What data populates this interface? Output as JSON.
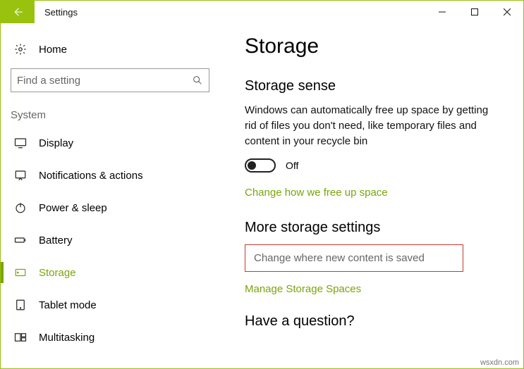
{
  "window": {
    "title": "Settings",
    "watermark": "wsxdn.com"
  },
  "sidebar": {
    "home": "Home",
    "search_placeholder": "Find a setting",
    "group": "System",
    "items": [
      {
        "label": "Display"
      },
      {
        "label": "Notifications & actions"
      },
      {
        "label": "Power & sleep"
      },
      {
        "label": "Battery"
      },
      {
        "label": "Storage"
      },
      {
        "label": "Tablet mode"
      },
      {
        "label": "Multitasking"
      }
    ]
  },
  "page": {
    "title": "Storage",
    "section1": {
      "heading": "Storage sense",
      "desc": "Windows can automatically free up space by getting rid of files you don't need, like temporary files and content in your recycle bin",
      "toggle_state": "Off",
      "link1": "Change how we free up space"
    },
    "section2": {
      "heading": "More storage settings",
      "boxed": "Change where new content is saved",
      "link2": "Manage Storage Spaces"
    },
    "section3": {
      "heading": "Have a question?"
    }
  }
}
